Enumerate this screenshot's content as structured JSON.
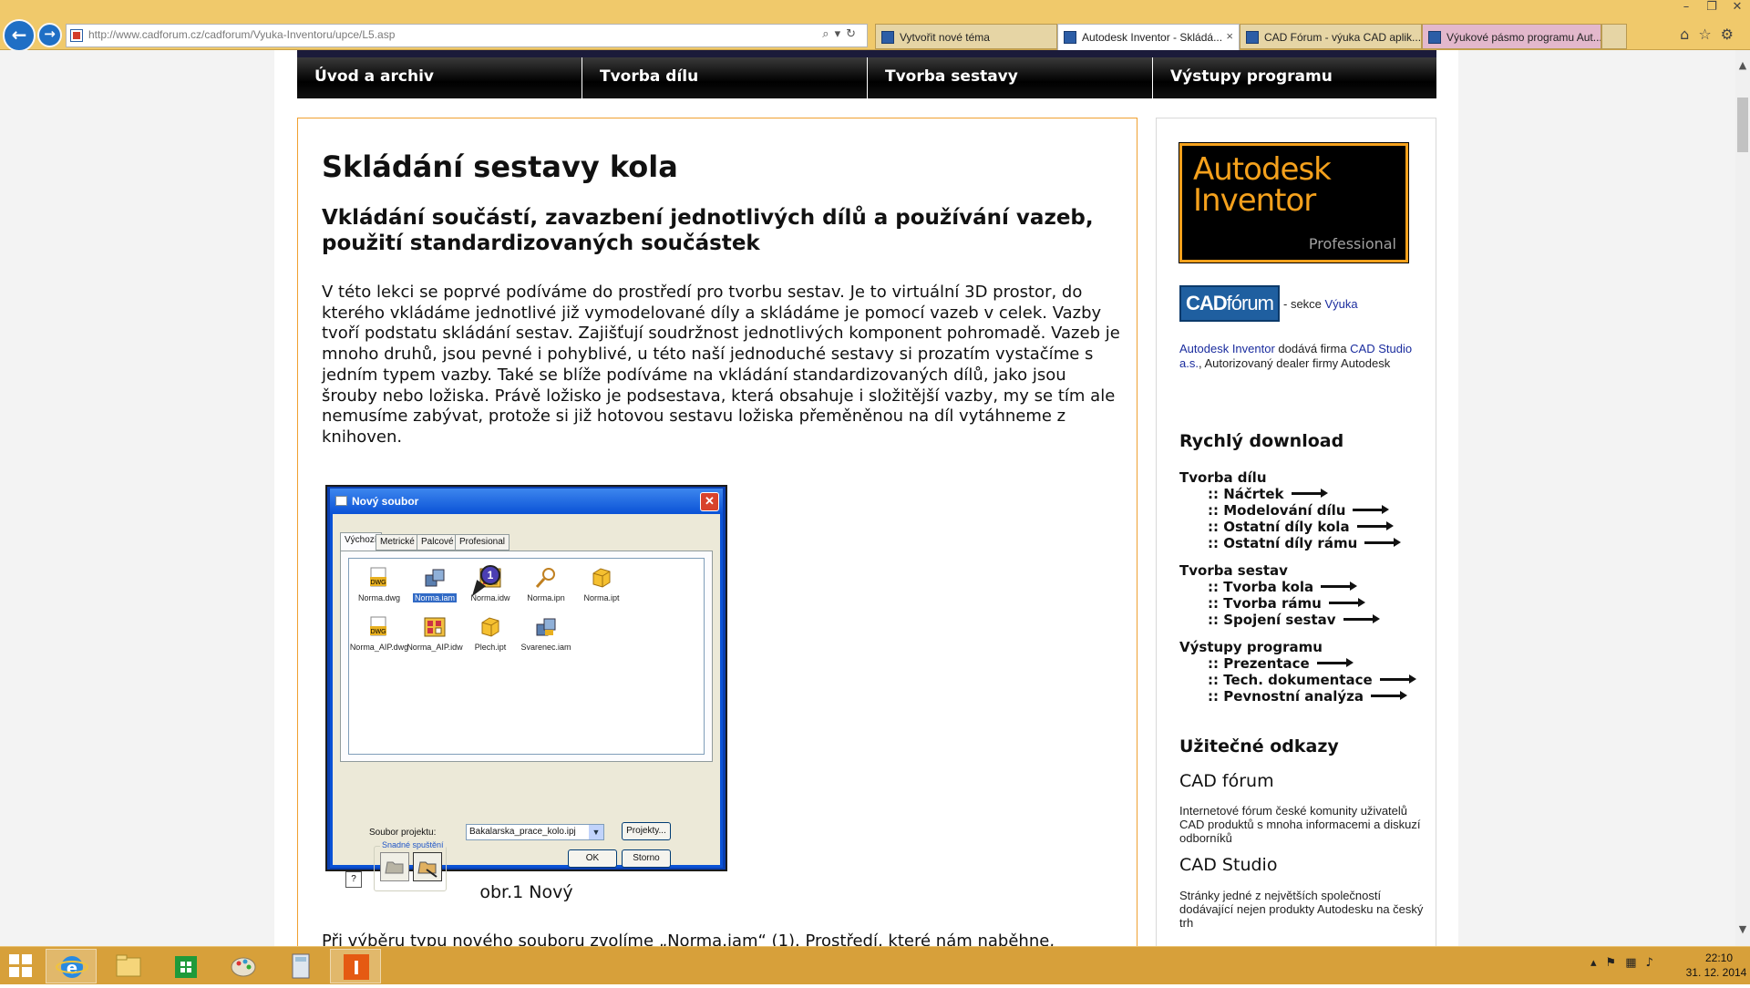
{
  "browser": {
    "url": "http://www.cadforum.cz/cadforum/Vyuka-Inventoru/upce/L5.asp",
    "tabs": [
      {
        "label": "Vytvořit nové téma"
      },
      {
        "label": "Autodesk Inventor - Skládá..."
      },
      {
        "label": "CAD Fórum - výuka CAD aplik..."
      },
      {
        "label": "Výukové pásmo programu Aut..."
      }
    ],
    "tab_close": "×",
    "colors": {
      "chrome": "#f0c96b",
      "taskbar": "#d7a03a",
      "accent": "#f5a11c"
    }
  },
  "nav": {
    "items": [
      "Úvod a archiv",
      "Tvorba dílu",
      "Tvorba sestavy",
      "Výstupy programu"
    ]
  },
  "article": {
    "title": "Skládání sestavy kola",
    "subtitle": "Vkládání součástí, zavazbení jednotlivých dílů a používání vazeb, použití standardizovaných součástek",
    "intro": "V této lekci se poprvé podíváme do prostředí pro tvorbu sestav. Je to virtuální 3D prostor, do kterého vkládáme jednotlivé již vymodelované díly a skládáme je pomocí vazeb v celek. Vazby tvoří podstatu skládání sestav. Zajišťují soudržnost jednotlivých komponent pohromadě. Vazeb je mnoho druhů, jsou pevné i pohyblivé, u této naší jednoduché sestavy si prozatím vystačíme s jedním typem vazby. Také se blíže podíváme na vkládání standardizovaných dílů, jako jsou šrouby nebo ložiska. Právě ložisko je podsestava, která obsahuje i složitější vazby, my se tím ale nemusíme zabývat, protože si již hotovou sestavu ložiska přeměněnou na díl vytáhneme z knihoven.",
    "figure_caption": "obr.1 Nový",
    "bottom_text": "Při výběru typu nového souboru zvolíme „Norma.iam“ (1). Prostředí, které nám naběhne,"
  },
  "dialog": {
    "title": "Nový soubor",
    "close": "✕",
    "tabs": [
      "Výchozí",
      "Metrické",
      "Palcové",
      "Profesional"
    ],
    "files": [
      "Norma.dwg",
      "Norma.iam",
      "Norma.idw",
      "Norma.ipn",
      "Norma.ipt",
      "Norma_AIP.dwg",
      "Norma_AIP.idw",
      "Plech.ipt",
      "Svarenec.iam"
    ],
    "callout": "1",
    "project_label": "Soubor projektu:",
    "project_value": "Bakalarska_prace_kolo.ipj",
    "projects_button": "Projekty...",
    "quick_launch": "Snadné spuštění",
    "ok": "OK",
    "cancel": "Storno",
    "help": "?"
  },
  "sidebar": {
    "logo_line1": "Autodesk",
    "logo_line2": "Inventor",
    "logo_line3": "Professional",
    "cadforum_bold": "CAD",
    "cadforum_thin": "fórum",
    "cadforum_prefix": " - sekce ",
    "cadforum_link": "Výuka",
    "dealer": {
      "link1": "Autodesk Inventor",
      "mid": " dodává firma ",
      "link2": "CAD Studio a.s.",
      "tail": ", Autorizovaný dealer firmy Autodesk"
    },
    "quick_download": {
      "heading": "Rychlý download",
      "groups": [
        {
          "title": "Tvorba dílu",
          "links": [
            ":: Náčrtek",
            ":: Modelování dílu",
            ":: Ostatní díly kola",
            ":: Ostatní díly rámu"
          ]
        },
        {
          "title": "Tvorba sestav",
          "links": [
            ":: Tvorba kola",
            ":: Tvorba rámu",
            ":: Spojení sestav"
          ]
        },
        {
          "title": "Výstupy programu",
          "links": [
            ":: Prezentace",
            ":: Tech. dokumentace",
            ":: Pevnostní analýza"
          ]
        }
      ]
    },
    "useful_links": {
      "heading": "Užitečné odkazy",
      "items": [
        {
          "title": "CAD fórum",
          "text": "Internetové fórum české komunity uživatelů CAD produktů s mnoha informacemi a diskuzí odborníků"
        },
        {
          "title": "CAD Studio",
          "text": "Stránky jedné z největších společností dodávající nejen produkty Autodesku na český trh"
        }
      ]
    }
  },
  "taskbar": {
    "time": "22:10",
    "date": "31. 12. 2014"
  }
}
